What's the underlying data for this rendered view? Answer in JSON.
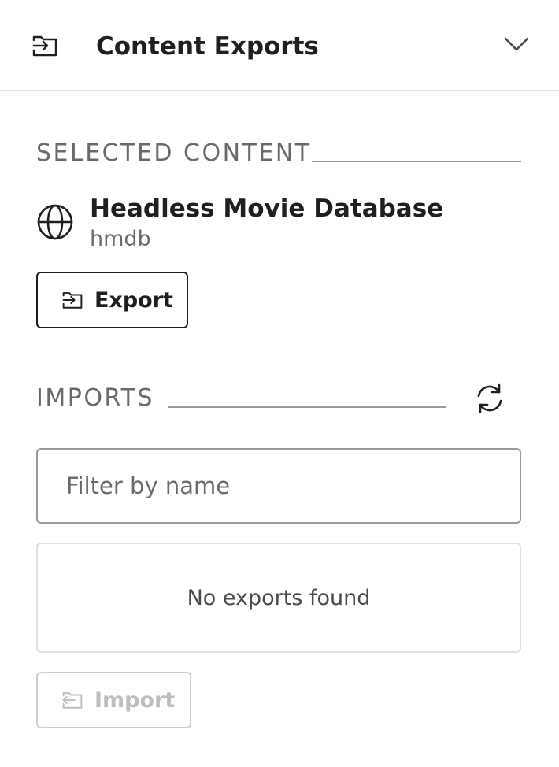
{
  "header": {
    "title": "Content Exports",
    "icon": "export-icon",
    "toggle_icon": "chevron-down-icon"
  },
  "selected_content": {
    "heading": "SELECTED CONTENT",
    "name": "Headless Movie Database",
    "id": "hmdb",
    "icon": "globe-icon",
    "export_label": "Export"
  },
  "imports": {
    "heading": "IMPORTS",
    "refresh_icon": "refresh-icon",
    "filter": {
      "placeholder": "Filter by name",
      "value": ""
    },
    "empty_message": "No exports found",
    "import_label": "Import",
    "import_disabled": true
  },
  "colors": {
    "text": "#1f1f1f",
    "muted": "#6a6a6a",
    "border": "#9a9a9a",
    "divider": "#e3e3e3",
    "disabled": "#bdbdbd"
  }
}
